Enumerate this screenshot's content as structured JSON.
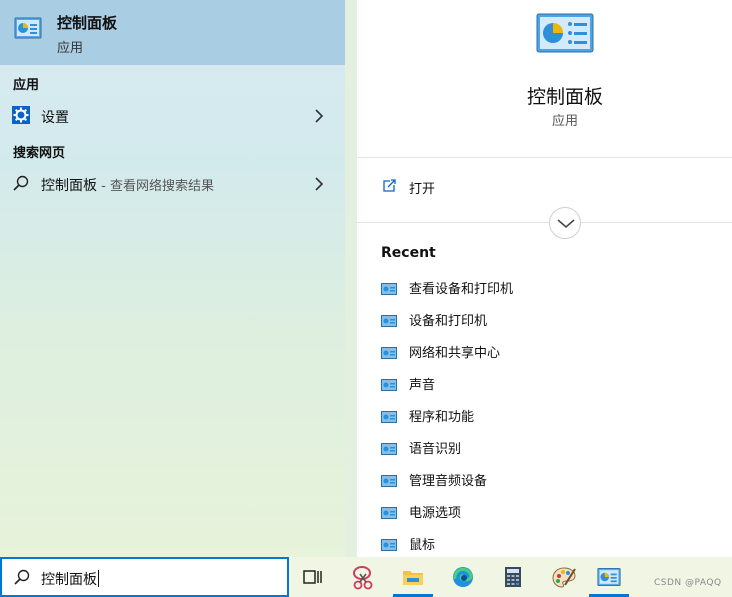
{
  "left": {
    "best_match": {
      "title": "控制面板",
      "subtitle": "应用",
      "icon": "control-panel-icon"
    },
    "sections": [
      {
        "heading": "应用",
        "items": [
          {
            "label": "设置",
            "suffix": "",
            "icon": "gear-icon"
          }
        ]
      },
      {
        "heading": "搜索网页",
        "items": [
          {
            "label": "控制面板",
            "suffix": " - 查看网络搜索结果",
            "icon": "search-icon"
          }
        ]
      }
    ]
  },
  "right": {
    "title": "控制面板",
    "subtitle": "应用",
    "open_label": "打开",
    "recent_heading": "Recent",
    "recent": [
      "查看设备和打印机",
      "设备和打印机",
      "网络和共享中心",
      "声音",
      "程序和功能",
      "语音识别",
      "管理音频设备",
      "电源选项",
      "鼠标"
    ]
  },
  "search": {
    "value": "控制面板",
    "icon": "search-icon"
  },
  "taskbar": {
    "buttons": [
      {
        "name": "task-view",
        "icon": "task-view-icon"
      },
      {
        "name": "snipping-tool",
        "icon": "scissors-icon"
      },
      {
        "name": "file-explorer",
        "icon": "folder-icon"
      },
      {
        "name": "edge",
        "icon": "edge-icon"
      },
      {
        "name": "calculator",
        "icon": "calculator-icon"
      },
      {
        "name": "paint",
        "icon": "palette-icon"
      },
      {
        "name": "control-panel",
        "icon": "control-panel-icon"
      }
    ]
  },
  "watermark": "CSDN @PAQQ",
  "colors": {
    "accent": "#0078d4",
    "best_match_bg": "#a9cde3"
  }
}
